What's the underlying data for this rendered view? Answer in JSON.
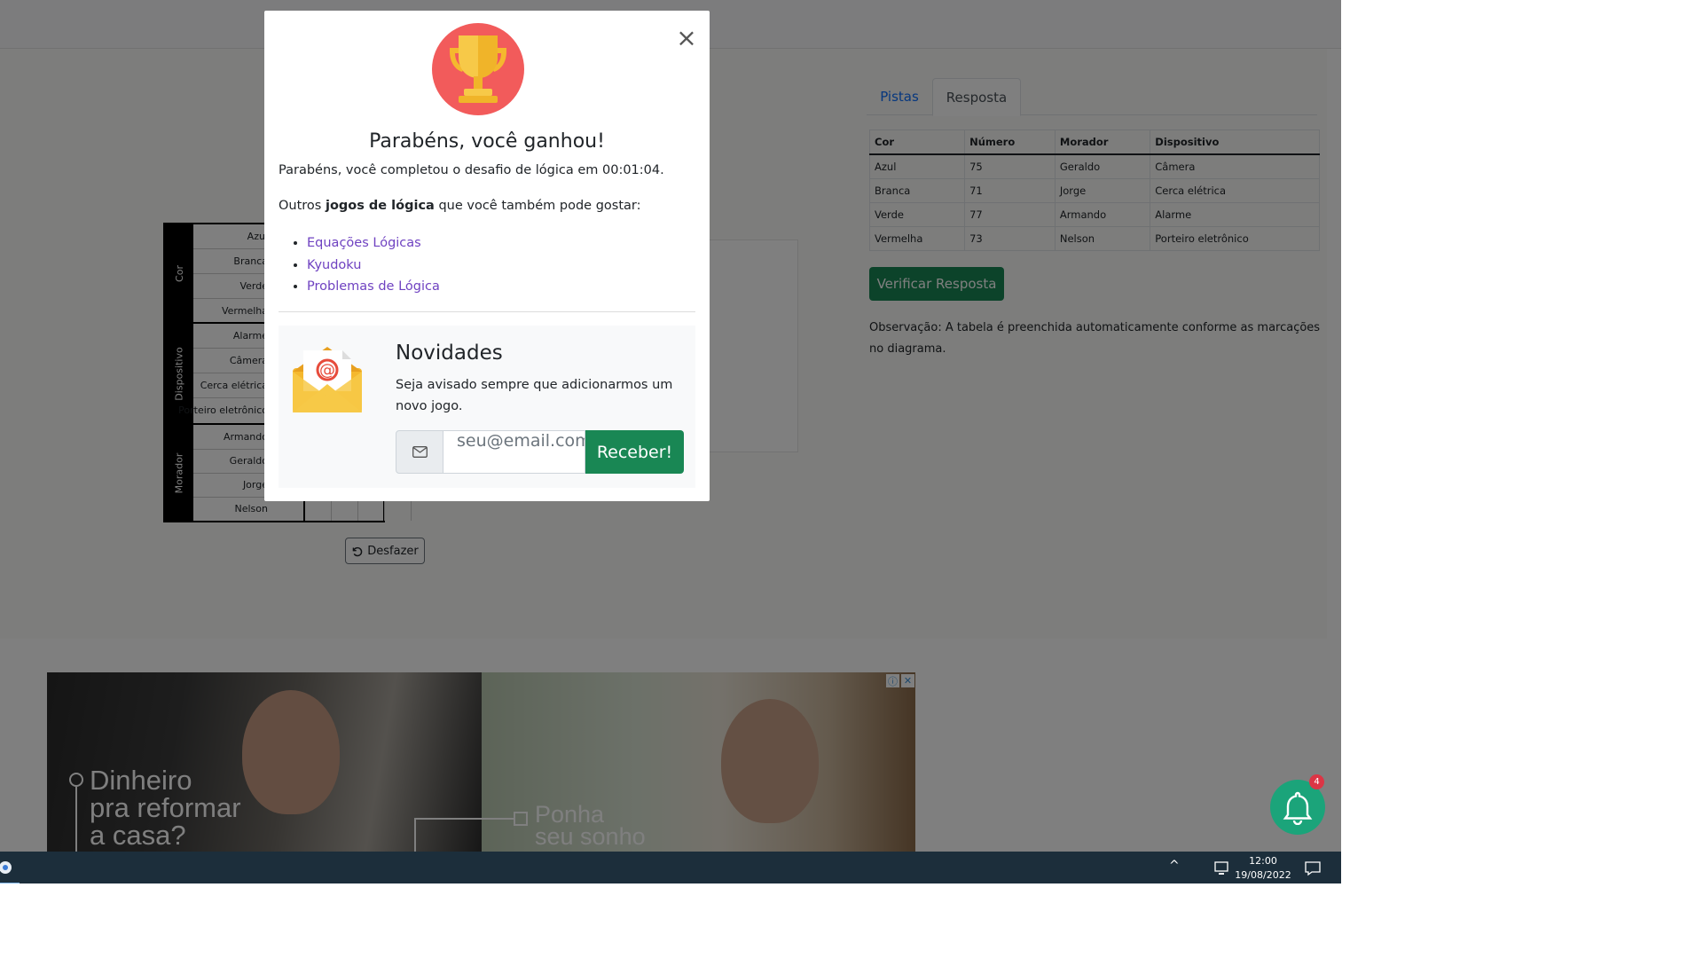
{
  "grid": {
    "sections": [
      {
        "label": "Cor",
        "rows": [
          "Azul",
          "Branca",
          "Verde",
          "Vermelha"
        ]
      },
      {
        "label": "Dispositivo",
        "rows": [
          "Alarme",
          "Câmera",
          "Cerca elétrica",
          "Porteiro eletrônico"
        ]
      },
      {
        "label": "Morador",
        "rows": [
          "Armando",
          "Geraldo",
          "Jorge",
          "Nelson"
        ]
      }
    ],
    "undo_label": "Desfazer"
  },
  "tabs": {
    "pistas": "Pistas",
    "resposta": "Resposta"
  },
  "answer_table": {
    "headers": [
      "Cor",
      "Número",
      "Morador",
      "Dispositivo"
    ],
    "rows": [
      [
        "Azul",
        "75",
        "Geraldo",
        "Câmera"
      ],
      [
        "Branca",
        "71",
        "Jorge",
        "Cerca elétrica"
      ],
      [
        "Verde",
        "77",
        "Armando",
        "Alarme"
      ],
      [
        "Vermelha",
        "73",
        "Nelson",
        "Porteiro eletrônico"
      ]
    ]
  },
  "verify_button": "Verificar Resposta",
  "note": "Observação: A tabela é preenchida automaticamente conforme as marcações no diagrama.",
  "modal": {
    "title": "Parabéns, você ganhou!",
    "completed_text": "Parabéns, você completou o desafio de lógica em 00:01:04.",
    "others_prefix": "Outros ",
    "others_bold": "jogos de lógica",
    "others_suffix": " que você também pode gostar:",
    "links": [
      "Equações Lógicas",
      "Kyudoku",
      "Problemas de Lógica"
    ],
    "close_symbol": "×"
  },
  "newsletter": {
    "title": "Novidades",
    "text": "Seja avisado sempre que adicionarmos um novo jogo.",
    "placeholder": "seu@email.com",
    "button": "Receber!"
  },
  "ad": {
    "text_left_lines": [
      "Dinheiro",
      "pra reformar",
      "a casa?"
    ],
    "text_right_lines": [
      "Ponha",
      "seu sonho"
    ],
    "info_symbol": "ⓘ",
    "close_symbol": "✕"
  },
  "bell_badge": "4",
  "taskbar": {
    "time": "12:00",
    "date": "19/08/2022",
    "chevron": "^"
  },
  "colors": {
    "success": "#198754",
    "link": "#6f42c1",
    "accent": "#1ba47a"
  }
}
